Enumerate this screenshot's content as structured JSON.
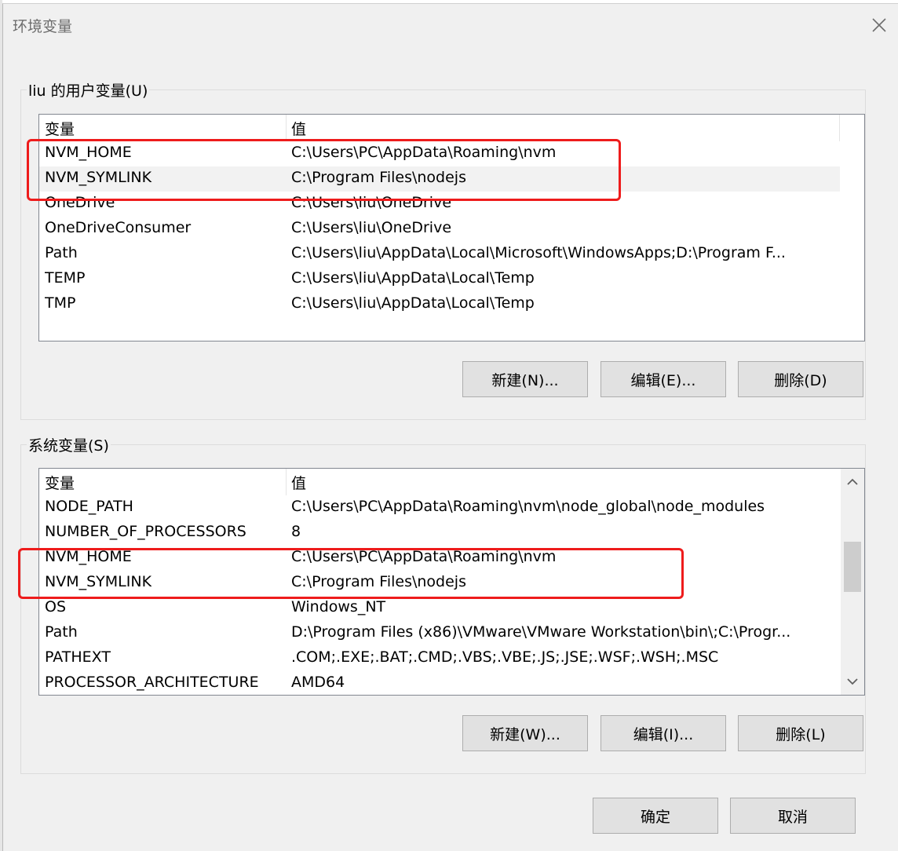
{
  "window": {
    "title": "环境变量",
    "close_icon": "close-icon"
  },
  "user_vars": {
    "group_label": "liu 的用户变量(U)",
    "header": {
      "name": "变量",
      "value": "值"
    },
    "rows": [
      {
        "name": "NVM_HOME",
        "value": "C:\\Users\\PC\\AppData\\Roaming\\nvm"
      },
      {
        "name": "NVM_SYMLINK",
        "value": "C:\\Program Files\\nodejs"
      },
      {
        "name": "OneDrive",
        "value": "C:\\Users\\liu\\OneDrive"
      },
      {
        "name": "OneDriveConsumer",
        "value": "C:\\Users\\liu\\OneDrive"
      },
      {
        "name": "Path",
        "value": "C:\\Users\\liu\\AppData\\Local\\Microsoft\\WindowsApps;D:\\Program F..."
      },
      {
        "name": "TEMP",
        "value": "C:\\Users\\liu\\AppData\\Local\\Temp"
      },
      {
        "name": "TMP",
        "value": "C:\\Users\\liu\\AppData\\Local\\Temp"
      }
    ],
    "buttons": {
      "new": "新建(N)...",
      "edit": "编辑(E)...",
      "delete": "删除(D)"
    }
  },
  "system_vars": {
    "group_label": "系统变量(S)",
    "header": {
      "name": "变量",
      "value": "值"
    },
    "rows": [
      {
        "name": "NODE_PATH",
        "value": "C:\\Users\\PC\\AppData\\Roaming\\nvm\\node_global\\node_modules"
      },
      {
        "name": "NUMBER_OF_PROCESSORS",
        "value": "8"
      },
      {
        "name": "NVM_HOME",
        "value": "C:\\Users\\PC\\AppData\\Roaming\\nvm"
      },
      {
        "name": "NVM_SYMLINK",
        "value": "C:\\Program Files\\nodejs"
      },
      {
        "name": "OS",
        "value": "Windows_NT"
      },
      {
        "name": "Path",
        "value": "D:\\Program Files (x86)\\VMware\\VMware Workstation\\bin\\;C:\\Progr..."
      },
      {
        "name": "PATHEXT",
        "value": ".COM;.EXE;.BAT;.CMD;.VBS;.VBE;.JS;.JSE;.WSF;.WSH;.MSC"
      },
      {
        "name": "PROCESSOR_ARCHITECTURE",
        "value": "AMD64"
      }
    ],
    "buttons": {
      "new": "新建(W)...",
      "edit": "编辑(I)...",
      "delete": "删除(L)"
    }
  },
  "footer": {
    "ok": "确定",
    "cancel": "取消"
  },
  "colors": {
    "highlight_box": "#ee1c1c",
    "selected_row": "#f2f2f2",
    "button_bg": "#e1e1e1"
  }
}
